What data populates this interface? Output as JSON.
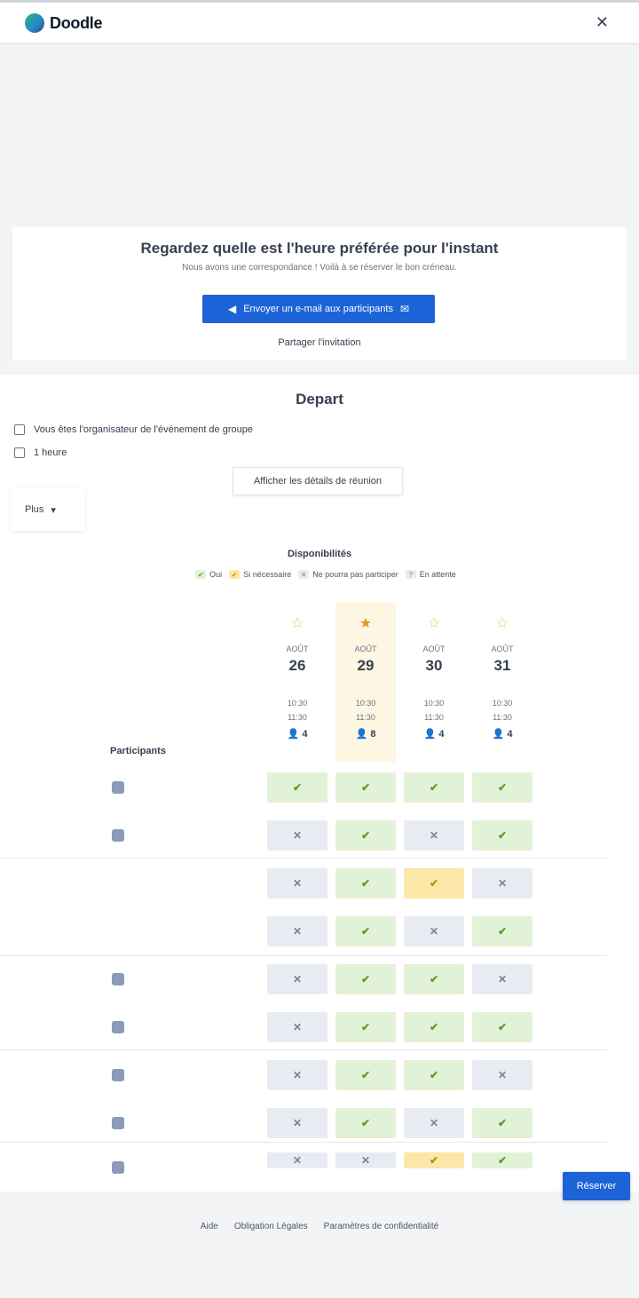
{
  "header": {
    "logo_text": "Doodle",
    "close_label": "✕"
  },
  "invite_card": {
    "title": "Regardez quelle est l'heure préférée pour l'instant",
    "subtitle": "Nous avons une correspondance ! Voilà à se réserver le bon créneau.",
    "primary_button": "Envoyer un e-mail aux participants",
    "share_link": "Partager l'invitation"
  },
  "event": {
    "title": "Depart",
    "organizer_text": "Vous êtes l'organisateur de l'événement de groupe",
    "time_text": "1 heure",
    "details_button": "Afficher les détails de réunion",
    "view_selector": "Plus"
  },
  "legend": {
    "title": "Disponibilités",
    "items": [
      {
        "label": "Oui",
        "kind": "yes",
        "glyph": "✔"
      },
      {
        "label": "Si nécessaire",
        "kind": "maybe",
        "glyph": "✔"
      },
      {
        "label": "Ne pourra pas participer",
        "kind": "no",
        "glyph": "✕"
      },
      {
        "label": "En attente",
        "kind": "pending",
        "glyph": "?"
      }
    ]
  },
  "columns": [
    {
      "month": "AOÛT",
      "day": "26",
      "start": "10:30",
      "end": "11:30",
      "count": "4"
    },
    {
      "month": "AOÛT",
      "day": "29",
      "start": "10:30",
      "end": "11:30",
      "count": "8",
      "preferred": true
    },
    {
      "month": "AOÛT",
      "day": "30",
      "start": "10:30",
      "end": "11:30",
      "count": "4"
    },
    {
      "month": "AOÛT",
      "day": "31",
      "start": "10:30",
      "end": "11:30",
      "count": "4"
    }
  ],
  "column_icons": {
    "default": "☆",
    "preferred": "★"
  },
  "participants_label": "Participants",
  "rows": [
    [
      "yes",
      "yes",
      "yes",
      "yes"
    ],
    [
      "no",
      "yes",
      "no",
      "yes"
    ],
    [
      "no",
      "yes",
      "maybe",
      "no"
    ],
    [
      "no",
      "yes",
      "no",
      "yes"
    ],
    [
      "no",
      "yes",
      "yes",
      "no"
    ],
    [
      "no",
      "yes",
      "yes",
      "yes"
    ],
    [
      "no",
      "yes",
      "yes",
      "no"
    ],
    [
      "no",
      "yes",
      "no",
      "yes"
    ],
    [
      "no",
      "no",
      "maybe",
      "yes"
    ]
  ],
  "cell_glyphs": {
    "yes": "✔",
    "no": "✕",
    "maybe": "✔"
  },
  "float_button": "Réserver",
  "footer": {
    "links": [
      "Aide",
      "Obligation Légales",
      "Paramètres de confidentialité"
    ]
  }
}
